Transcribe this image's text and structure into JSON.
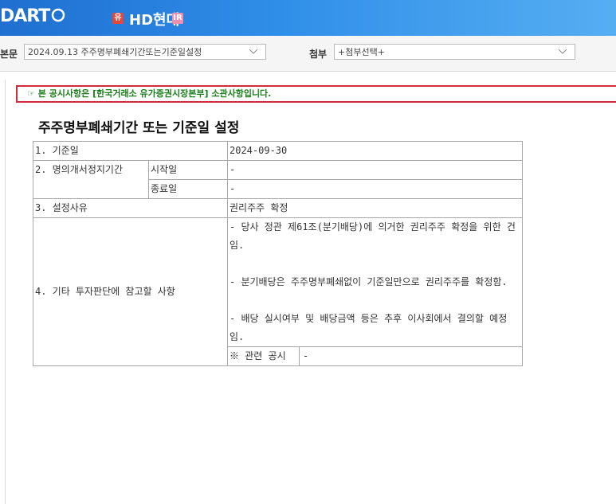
{
  "header": {
    "logo_text": "DART",
    "badge_yu": "유",
    "company_name": "HD현대",
    "badge_ir": "IR",
    "brand_color": "#2a86e0"
  },
  "toolbar": {
    "body_label": "본문",
    "body_select_value": "2024.09.13  주주명부폐쇄기간또는기준일설정",
    "attach_label": "첨부",
    "attach_select_value": "+첨부선택+"
  },
  "notice": {
    "text": "☞ 본 공시사항은 [한국거래소 유가증권시장본부] 소관사항입니다."
  },
  "document": {
    "title": "주주명부폐쇄기간 또는 기준일 설정",
    "rows": {
      "base_date_label": "1. 기준일",
      "base_date_value": "2024-09-30",
      "suspension_label": "2. 명의개서정지기간",
      "start_label": "시작일",
      "start_value": "-",
      "end_label": "종료일",
      "end_value": "-",
      "reason_label": "3. 설정사유",
      "reason_value": "권리주주 확정",
      "other_label": "4. 기타 투자판단에 참고할 사항",
      "other_para1": "- 당사 정관 제61조(분기배당)에 의거한 권리주주 확정을 위한 건임.",
      "other_para2": "- 분기배당은 주주명부폐쇄없이 기준일만으로 권리주주를 확정함.",
      "other_para3": "- 배당 실시여부 및 배당금액 등은 추후 이사회에서 결의할 예정임.",
      "related_label": "※ 관련 공시",
      "related_value": "-"
    }
  }
}
